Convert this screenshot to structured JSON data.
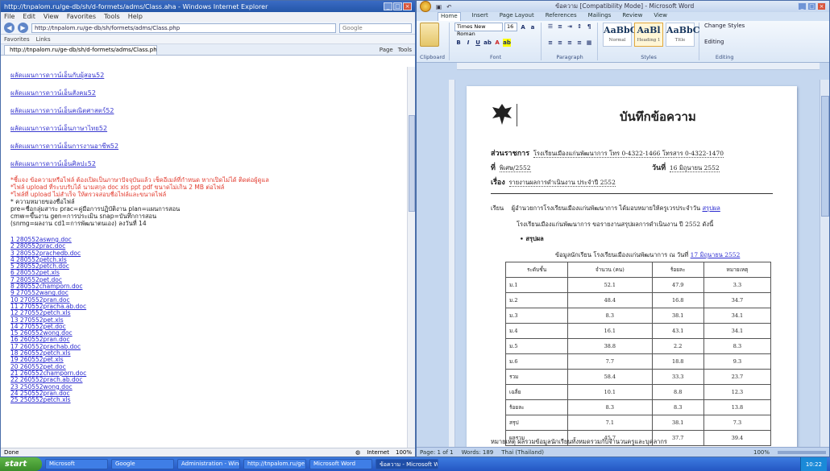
{
  "ie": {
    "title": "http://tnpalom.ru/ge-db/sh/d-formets/adms/Class.aha - Windows Internet Explorer",
    "menu": [
      "File",
      "Edit",
      "View",
      "Favorites",
      "Tools",
      "Help"
    ],
    "address": "http://tnpalom.ru/ge-db/sh/formets/adms/Class.php",
    "search_placeholder": "Google",
    "links_bar": [
      "Favorites",
      "Links"
    ],
    "tab_label": "http://tnpalom.ru/ge-db/sh/d-formets/adms/Class.php",
    "tools": [
      "Page",
      "Tools"
    ],
    "big_links": [
      "ผลัดแผนการดาวน์เอ็นกับผู้สอน52",
      "ผลัดแผนการดาวน์เอ็นสังคม52",
      "ผลัดแผนการดาวน์เอ็นคณิตศาสตร์52",
      "ผลัดแผนการดาวน์เอ็นภาษาไทย52",
      "ผลัดแผนการดาวน์เอ็นการงานอาชีพ52",
      "ผลัดแผนการดาวน์เอ็นศิลปะ52"
    ],
    "red_notes": [
      "*ชี้แจง ข้อความหรือไฟล์ ต้องเปิดเป็นภาษาปัจจุบันแล้ว เช็คอีเมล์ที่กำหนด หากเปิดไม่ได้ ติดต่อผู้ดูแล",
      "*ไฟล์ upload ที่ระบบรับได้ นามสกุล doc xls ppt pdf ขนาดไม่เกิน 2 MB ต่อไฟล์",
      "*ไฟล์ที่ upload ไม่สำเร็จ ให้ตรวจสอบชื่อไฟล์และขนาดไฟล์"
    ],
    "dark_notes": [
      "* ความหมายของชื่อไฟล์",
      "pre=ชื่อกลุ่มสาระ  prac=คู่มือการปฏิบัติงาน  plan=แผนการสอน",
      "cmw=ขึ้นงาน  gen=การประเมิน  snap=บันทึกการสอน",
      "(snmg=ผลงาน  cd1=การพัฒนาตนเอง)  ลงวันที่ 14"
    ],
    "files": [
      "1  280552aswng.doc",
      "2  280552prac.doc",
      "3  280552prachedb.doc",
      "4  280552petch.xls",
      "5  280552petch.doc",
      "6  280552pet.xls",
      "7  280552pet.doc",
      "8  280552champorn.doc",
      "9  270552wang.doc",
      "10  270552pran.doc",
      "11  270552pracha.ab.doc",
      "12  270552petch.xls",
      "13  270552pet.xls",
      "14  270552pet.doc",
      "15  260552wong.doc",
      "16  260552pran.doc",
      "17  260552prachab.doc",
      "18  260552petch.xls",
      "19  260552pet.xls",
      "20  260552pet.doc",
      "21  260552champorn.doc",
      "22  260552prach.ab.doc",
      "23  250552wong.doc",
      "24  250552pran.doc",
      "25  250552petch.xls"
    ],
    "status_left": "Done",
    "status_zone": "Internet",
    "status_zoom": "100%"
  },
  "word": {
    "title": "ข้อความ [Compatibility Mode] - Microsoft Word",
    "tabs": [
      "Home",
      "Insert",
      "Page Layout",
      "References",
      "Mailings",
      "Review",
      "View"
    ],
    "active_tab": "Home",
    "font_name": "Times New Roman",
    "font_size": "16",
    "group_labels": [
      "Clipboard",
      "Font",
      "Paragraph",
      "Styles",
      "Editing"
    ],
    "styles": [
      {
        "sample": "AaBbC",
        "caption": "Normal"
      },
      {
        "sample": "AaBl",
        "caption": "Heading 1"
      },
      {
        "sample": "AaBbC",
        "caption": "Title"
      }
    ],
    "change_styles": "Change Styles",
    "editing": "Editing",
    "memo_title": "บันทึกข้อความ",
    "agency_label": "ส่วนราชการ",
    "agency_value": "โรงเรียนเมืองแก่นพัฒนาการ  โทร 0-4322-1466  โทรสาร 0-4322-1470",
    "ref_label": "ที่",
    "ref_value": "พิเศษ/2552",
    "date_label": "วันที่",
    "date_value": "16  มิถุนายน  2552",
    "subject_label": "เรื่อง",
    "subject_value": "รายงานผลการดำเนินงาน ประจำปี 2552",
    "to_label": "เรียน",
    "body_1": "ผู้อำนวยการโรงเรียนเมืองแก่นพัฒนาการ ได้มอบหมายให้ครูเวรประจำวัน",
    "body_1_link": "สรุปผล",
    "body_2": "โรงเรียนเมืองแก่นพัฒนาการ ขอรายงานสรุปผลการดำเนินงาน ปี 2552 ดังนี้",
    "bullet": "• สรุปผล",
    "table_caption_pre": "ข้อมูลนักเรียน โรงเรียนเมืองแก่นพัฒนาการ  ณ วันที่",
    "table_caption_link": "17 มิถุนายน 2552",
    "table_headers": [
      "ระดับชั้น",
      "จำนวน (คน)",
      "ร้อยละ",
      "หมายเหตุ"
    ],
    "table_rows": [
      [
        "ม.1",
        "52.1",
        "47.9",
        "3.3"
      ],
      [
        "ม.2",
        "48.4",
        "16.8",
        "34.7"
      ],
      [
        "ม.3",
        "8.3",
        "38.1",
        "34.1"
      ],
      [
        "ม.4",
        "16.1",
        "43.1",
        "34.1"
      ],
      [
        "ม.5",
        "38.8",
        "2.2",
        "8.3"
      ],
      [
        "ม.6",
        "7.7",
        "18.8",
        "9.3"
      ],
      [
        "รวม",
        "58.4",
        "33.3",
        "23.7"
      ],
      [
        "เฉลี่ย",
        "10.1",
        "8.8",
        "12.3"
      ],
      [
        "ร้อยละ",
        "8.3",
        "8.3",
        "13.8"
      ],
      [
        "สรุป",
        "7.1",
        "38.1",
        "7.3"
      ],
      [
        "ผลรวม",
        "45.7",
        "37.7",
        "39.4"
      ]
    ],
    "footer_line_1": "หมายเหตุ  ผลรวมข้อมูลนักเรียนทั้งหมดรวมกับจำนวนครูและบุคลากร",
    "footer_line_2": "ข้อมูลดังกล่าวใช้ประกอบการประเมินผล ตามรายการที่ได้รับ",
    "status_page": "Page: 1 of 1",
    "status_words": "Words: 189",
    "status_lang": "Thai (Thailand)",
    "status_zoom": "100%"
  },
  "taskbar": {
    "start": "start",
    "tasks": [
      {
        "label": "Microsoft",
        "active": false
      },
      {
        "label": "Google",
        "active": false
      },
      {
        "label": "Administration - Windows",
        "active": false
      },
      {
        "label": "http://tnpalom.ru/ge",
        "active": false
      },
      {
        "label": "Microsoft Word",
        "active": false
      },
      {
        "label": "ข้อความ - Microsoft Word",
        "active": true
      }
    ],
    "clock": "10:22"
  },
  "colors": {
    "link": "#2a2ad0",
    "red_note": "#e23b2e",
    "taskbar": "#2457c3",
    "start": "#3a8d2a"
  }
}
